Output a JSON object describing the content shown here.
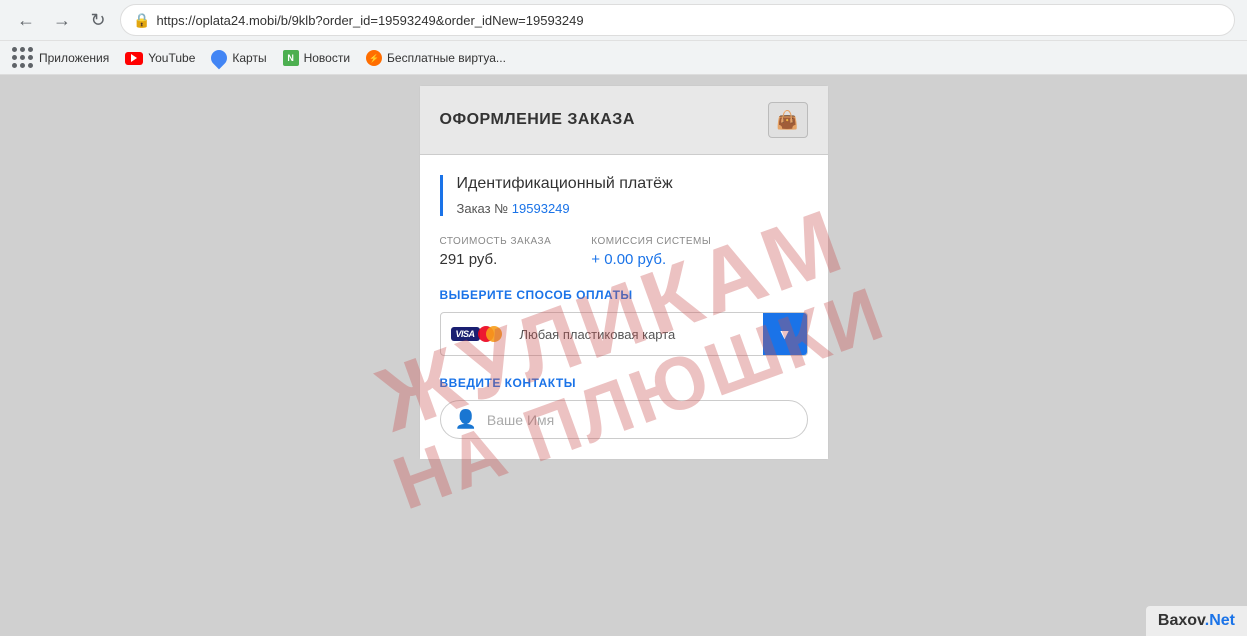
{
  "browser": {
    "back_btn": "←",
    "forward_btn": "→",
    "refresh_btn": "↻",
    "url": "https://oplata24.mobi/b/9klb?order_id=19593249&order_idNew=19593249",
    "lock_icon": "🔒",
    "bookmarks": [
      {
        "label": "Приложения",
        "type": "apps"
      },
      {
        "label": "YouTube",
        "type": "youtube"
      },
      {
        "label": "Карты",
        "type": "maps"
      },
      {
        "label": "Новости",
        "type": "news"
      },
      {
        "label": "Бесплатные виртуа...",
        "type": "free"
      }
    ]
  },
  "panel": {
    "title": "ОФОРМЛЕНИЕ ЗАКАЗА",
    "wallet_icon": "👜",
    "order_section": {
      "title": "Идентификационный платёж",
      "order_label": "Заказ №",
      "order_number": "19593249"
    },
    "price_section": {
      "cost_label": "СТОИМОСТЬ ЗАКАЗА",
      "cost_value": "291 руб.",
      "commission_label": "КОМИССИЯ СИСТЕМЫ",
      "commission_value": "+ 0.00 руб."
    },
    "payment_section": {
      "label": "ВЫБЕРИТЕ СПОСОБ ОПЛАТЫ",
      "selected_option": "Любая пластиковая карта",
      "dropdown_arrow": "▼"
    },
    "contacts_section": {
      "label": "ВВЕДИТЕ КОНТАКТЫ",
      "name_placeholder": "Ваше Имя",
      "person_icon": "👤"
    }
  },
  "watermark": {
    "line1": "ЖУЛИКАМ",
    "line2": "НА ПЛЮШКИ"
  },
  "badge": {
    "text": "Baxov",
    "suffix": ".Net"
  }
}
